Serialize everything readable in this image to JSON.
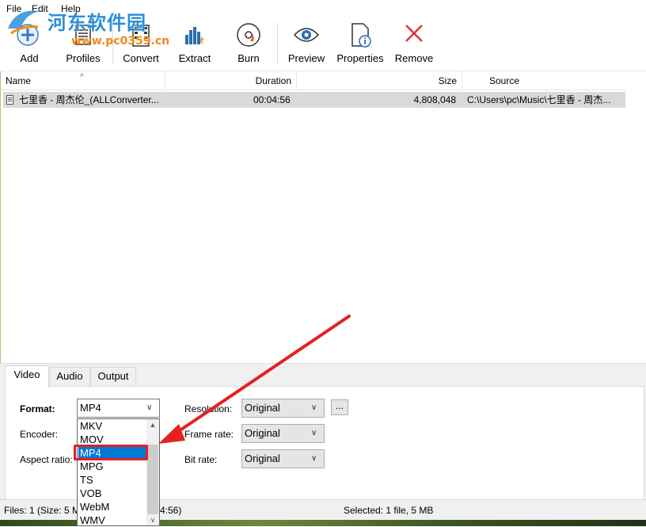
{
  "menu": {
    "file": "File",
    "edit": "Edit",
    "help": "Help"
  },
  "watermark": {
    "site_cn": "河东软件园",
    "url": "www.pc0359.cn"
  },
  "toolbar": {
    "add": "Add",
    "profiles": "Profiles",
    "convert": "Convert",
    "extract": "Extract",
    "burn": "Burn",
    "preview": "Preview",
    "properties": "Properties",
    "remove": "Remove"
  },
  "file_list": {
    "columns": {
      "name": "Name",
      "duration": "Duration",
      "size": "Size",
      "source": "Source"
    },
    "rows": [
      {
        "name": "七里香 - 周杰伦_(ALLConverter...",
        "duration": "00:04:56",
        "size": "4,808,048",
        "source": "C:\\Users\\pc\\Music\\七里香 - 周杰..."
      }
    ]
  },
  "tabs": {
    "video": "Video",
    "audio": "Audio",
    "output": "Output"
  },
  "video_settings": {
    "format_label": "Format:",
    "format_value": "MP4",
    "encoder_label": "Encoder:",
    "aspect_label": "Aspect ratio:",
    "resolution_label": "Resolution:",
    "resolution_value": "Original",
    "resolution_more": "...",
    "framerate_label": "Frame rate:",
    "framerate_value": "Original",
    "bitrate_label": "Bit rate:",
    "bitrate_value": "Original"
  },
  "format_options": [
    "MKV",
    "MOV",
    "MP4",
    "MPG",
    "TS",
    "VOB",
    "WebM",
    "WMV"
  ],
  "format_selected": "MP4",
  "status": {
    "files_left": "Files: 1 (Size: 5 M",
    "files_right": "4:56)",
    "selected": "Selected: 1 file, 5 MB"
  },
  "colors": {
    "highlight_red": "#e62020",
    "selection_blue": "#0078d7",
    "watermark_blue": "#2b8fd8",
    "watermark_orange": "#f08a1c"
  },
  "icons": [
    "add-icon",
    "profiles-icon",
    "convert-icon",
    "extract-icon",
    "burn-icon",
    "preview-icon",
    "properties-icon",
    "remove-icon"
  ]
}
